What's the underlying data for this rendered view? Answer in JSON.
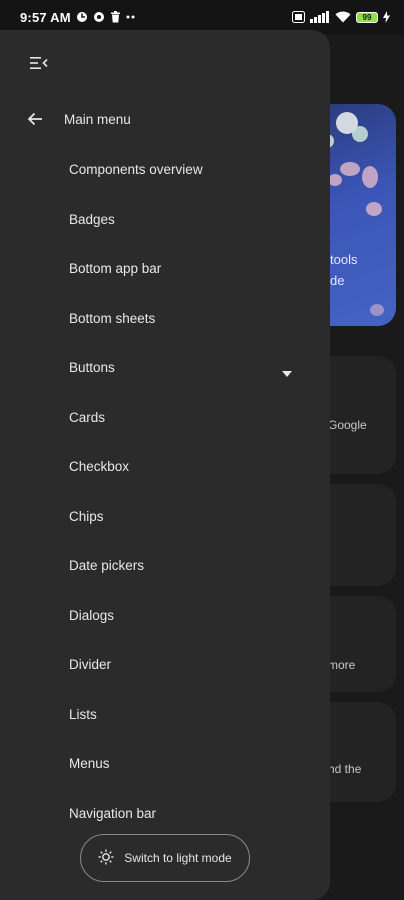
{
  "status_bar": {
    "time": "9:57 AM",
    "battery_level": "99",
    "icons": [
      "clock-icon",
      "settings-icon",
      "trash-icon",
      "more-icon",
      "nfc-icon",
      "signal-icon",
      "wifi-icon",
      "battery-icon",
      "charging-icon"
    ]
  },
  "background": {
    "hero_line1": "tools",
    "hero_line2": "de",
    "card1_text": "Google",
    "card2_text": "more",
    "card3_text": "nd the"
  },
  "drawer": {
    "back_label": "Main menu",
    "items": [
      {
        "label": "Components overview"
      },
      {
        "label": "Badges"
      },
      {
        "label": "Bottom app bar"
      },
      {
        "label": "Bottom sheets"
      },
      {
        "label": "Buttons",
        "expandable": true
      },
      {
        "label": "Cards"
      },
      {
        "label": "Checkbox"
      },
      {
        "label": "Chips"
      },
      {
        "label": "Date pickers"
      },
      {
        "label": "Dialogs"
      },
      {
        "label": "Divider"
      },
      {
        "label": "Lists"
      },
      {
        "label": "Menus"
      },
      {
        "label": "Navigation bar"
      }
    ],
    "theme_button_label": "Switch to light mode"
  }
}
